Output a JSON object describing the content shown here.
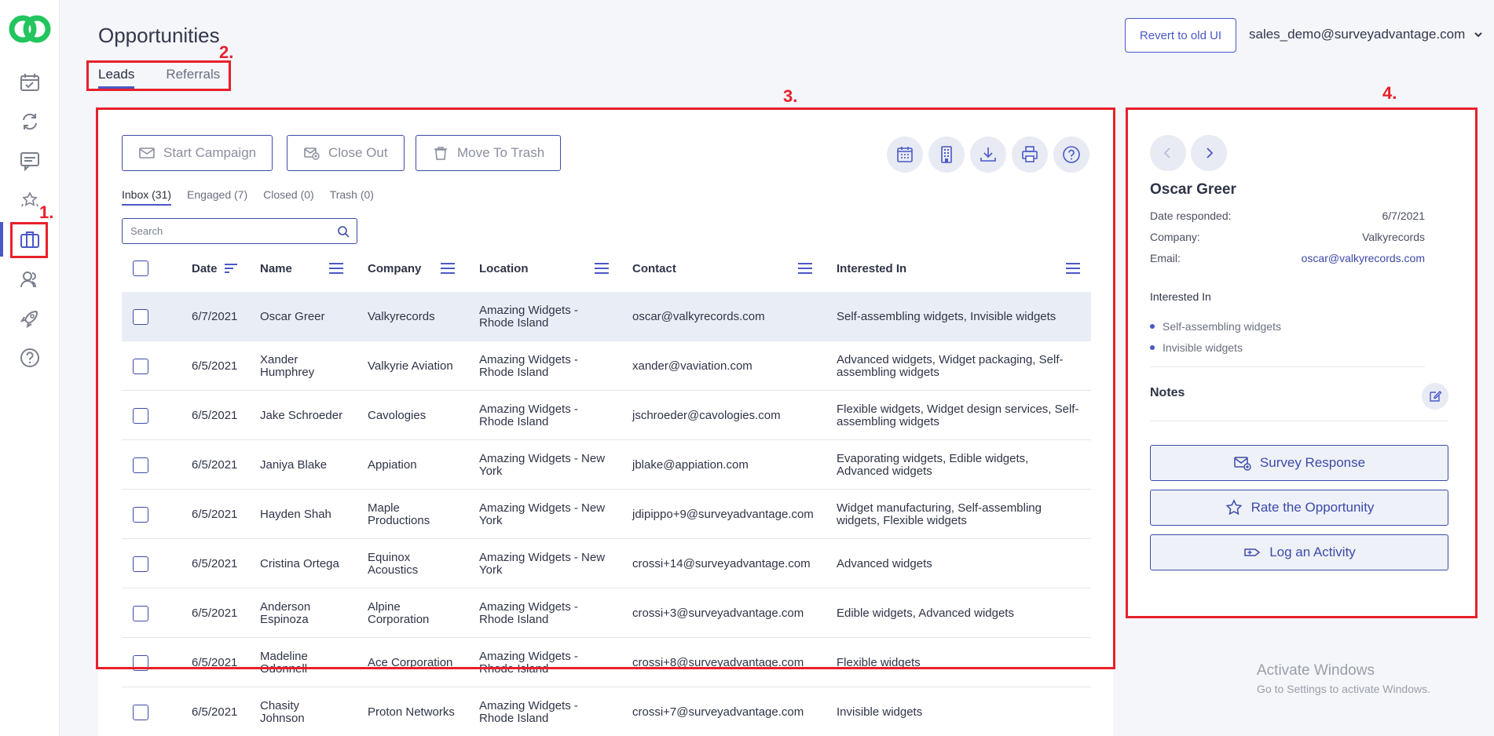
{
  "page": {
    "title": "Opportunities",
    "tabs": [
      {
        "label": "Leads",
        "active": true
      },
      {
        "label": "Referrals",
        "active": false
      }
    ],
    "revert_button": "Revert to old UI",
    "user_email": "sales_demo@surveyadvantage.com"
  },
  "sidebar": {
    "items": [
      {
        "icon": "calendar-check-icon"
      },
      {
        "icon": "refresh-icon"
      },
      {
        "icon": "chat-icon"
      },
      {
        "icon": "stars-icon"
      },
      {
        "icon": "briefcase-icon",
        "active": true
      },
      {
        "icon": "users-icon"
      },
      {
        "icon": "rocket-icon"
      },
      {
        "icon": "help-icon"
      }
    ]
  },
  "annotations": [
    "1.",
    "2.",
    "3.",
    "4."
  ],
  "toolbar": {
    "start_campaign": "Start Campaign",
    "close_out": "Close Out",
    "move_to_trash": "Move To Trash",
    "icons": [
      "calendar-icon",
      "building-icon",
      "download-icon",
      "print-icon",
      "help-icon"
    ]
  },
  "subtabs": [
    {
      "label": "Inbox (31)",
      "active": true
    },
    {
      "label": "Engaged (7)",
      "active": false
    },
    {
      "label": "Closed (0)",
      "active": false
    },
    {
      "label": "Trash (0)",
      "active": false
    }
  ],
  "search": {
    "placeholder": "Search",
    "value": ""
  },
  "table": {
    "columns": [
      "Date",
      "Name",
      "Company",
      "Location",
      "Contact",
      "Interested In"
    ],
    "rows": [
      {
        "date": "6/7/2021",
        "name": "Oscar Greer",
        "company": "Valkyrecords",
        "location": "Amazing Widgets - Rhode Island",
        "contact": "oscar@valkyrecords.com",
        "interested": "Self-assembling widgets, Invisible widgets",
        "selected": true
      },
      {
        "date": "6/5/2021",
        "name": "Xander Humphrey",
        "company": "Valkyrie Aviation",
        "location": "Amazing Widgets - Rhode Island",
        "contact": "xander@vaviation.com",
        "interested": "Advanced widgets, Widget packaging, Self-assembling widgets"
      },
      {
        "date": "6/5/2021",
        "name": "Jake Schroeder",
        "company": "Cavologies",
        "location": "Amazing Widgets - Rhode Island",
        "contact": "jschroeder@cavologies.com",
        "interested": "Flexible widgets, Widget design services, Self-assembling widgets"
      },
      {
        "date": "6/5/2021",
        "name": "Janiya Blake",
        "company": "Appiation",
        "location": "Amazing Widgets - New York",
        "contact": "jblake@appiation.com",
        "interested": "Evaporating widgets, Edible widgets, Advanced widgets"
      },
      {
        "date": "6/5/2021",
        "name": "Hayden Shah",
        "company": "Maple Productions",
        "location": "Amazing Widgets - New York",
        "contact": "jdipippo+9@surveyadvantage.com",
        "interested": "Widget manufacturing, Self-assembling widgets, Flexible widgets"
      },
      {
        "date": "6/5/2021",
        "name": "Cristina Ortega",
        "company": "Equinox Acoustics",
        "location": "Amazing Widgets - New York",
        "contact": "crossi+14@surveyadvantage.com",
        "interested": "Advanced widgets"
      },
      {
        "date": "6/5/2021",
        "name": "Anderson Espinoza",
        "company": "Alpine Corporation",
        "location": "Amazing Widgets - Rhode Island",
        "contact": "crossi+3@surveyadvantage.com",
        "interested": "Edible widgets, Advanced widgets"
      },
      {
        "date": "6/5/2021",
        "name": "Madeline Odonnell",
        "company": "Ace Corporation",
        "location": "Amazing Widgets - Rhode Island",
        "contact": "crossi+8@surveyadvantage.com",
        "interested": "Flexible widgets"
      },
      {
        "date": "6/5/2021",
        "name": "Chasity Johnson",
        "company": "Proton Networks",
        "location": "Amazing Widgets - Rhode Island",
        "contact": "crossi+7@surveyadvantage.com",
        "interested": "Invisible widgets"
      }
    ]
  },
  "detail": {
    "name": "Oscar Greer",
    "date_label": "Date responded:",
    "date_value": "6/7/2021",
    "company_label": "Company:",
    "company_value": "Valkyrecords",
    "email_label": "Email:",
    "email_value": "oscar@valkyrecords.com",
    "interested_title": "Interested In",
    "interests": [
      "Self-assembling widgets",
      "Invisible widgets"
    ],
    "notes_title": "Notes",
    "survey_response": "Survey Response",
    "rate_opportunity": "Rate the Opportunity",
    "log_activity": "Log an Activity"
  },
  "watermark": {
    "line1": "Activate Windows",
    "line2": "Go to Settings to activate Windows."
  },
  "colors": {
    "accent": "#4a58c7",
    "annotation": "#e8202a",
    "logo": "#22c55e"
  }
}
